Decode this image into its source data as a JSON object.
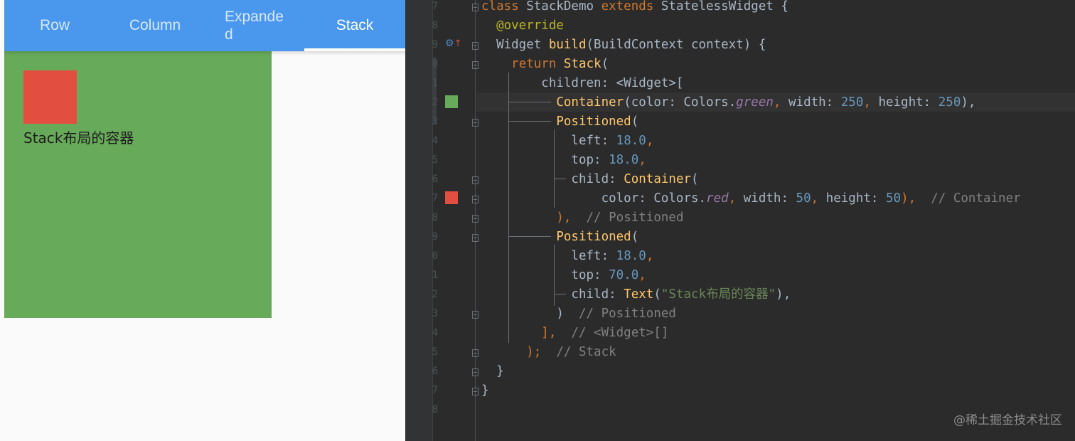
{
  "app": {
    "tabs": [
      {
        "label": "Row"
      },
      {
        "label": "Column"
      },
      {
        "label": "Expanded"
      },
      {
        "label": "Stack"
      }
    ],
    "active_tab": "Stack",
    "stack_text": "Stack布局的容器",
    "colors": {
      "tabbar": "#4a97ee",
      "green": "#67aa5a",
      "red": "#e24e3f"
    }
  },
  "editor": {
    "line_numbers": [
      "7",
      "8",
      "9",
      "0",
      "1",
      "2",
      "3",
      "4",
      "5",
      "6",
      "7",
      "8",
      "9",
      "0",
      "1",
      "2",
      "3",
      "4",
      "5",
      "6",
      "7",
      "8"
    ],
    "code_lines": [
      [
        {
          "t": "class ",
          "c": "kw"
        },
        {
          "t": "StackDemo "
        },
        {
          "t": "extends ",
          "c": "kw"
        },
        {
          "t": "StatelessWidget {"
        }
      ],
      [
        {
          "t": "  "
        },
        {
          "t": "@override",
          "c": "an"
        }
      ],
      [
        {
          "t": "  Widget "
        },
        {
          "t": "build",
          "c": "fn"
        },
        {
          "t": "(BuildContext context) {"
        }
      ],
      [
        {
          "t": "    "
        },
        {
          "t": "return ",
          "c": "kw"
        },
        {
          "t": "Stack",
          "c": "fn"
        },
        {
          "t": "("
        }
      ],
      [
        {
          "t": "        children: <Widget>["
        }
      ],
      [
        {
          "t": "          "
        },
        {
          "t": "Container",
          "c": "fn"
        },
        {
          "t": "(color: Colors."
        },
        {
          "t": "green",
          "c": "it"
        },
        {
          "t": ", ",
          "c": "kw"
        },
        {
          "t": "width: "
        },
        {
          "t": "250",
          "c": "nm"
        },
        {
          "t": ", ",
          "c": "kw"
        },
        {
          "t": "height: "
        },
        {
          "t": "250",
          "c": "nm"
        },
        {
          "t": "),"
        },
        {
          "t": "",
          "c": "kw"
        }
      ],
      [
        {
          "t": "          "
        },
        {
          "t": "Positioned",
          "c": "fn"
        },
        {
          "t": "("
        }
      ],
      [
        {
          "t": "            left: "
        },
        {
          "t": "18.0",
          "c": "nm"
        },
        {
          "t": ",",
          "c": "kw"
        }
      ],
      [
        {
          "t": "            top: "
        },
        {
          "t": "18.0",
          "c": "nm"
        },
        {
          "t": ",",
          "c": "kw"
        }
      ],
      [
        {
          "t": "            child: "
        },
        {
          "t": "Container",
          "c": "fn"
        },
        {
          "t": "("
        }
      ],
      [
        {
          "t": "                color: Colors."
        },
        {
          "t": "red",
          "c": "it"
        },
        {
          "t": ", ",
          "c": "kw"
        },
        {
          "t": "width: "
        },
        {
          "t": "50",
          "c": "nm"
        },
        {
          "t": ", ",
          "c": "kw"
        },
        {
          "t": "height: "
        },
        {
          "t": "50",
          "c": "nm"
        },
        {
          "t": "), ",
          "c": "kw"
        },
        {
          "t": " // Container",
          "c": "cm"
        }
      ],
      [
        {
          "t": "          ),",
          "c": "kw"
        },
        {
          "t": "  // Positioned",
          "c": "cm"
        }
      ],
      [
        {
          "t": "          "
        },
        {
          "t": "Positioned",
          "c": "fn"
        },
        {
          "t": "("
        }
      ],
      [
        {
          "t": "            left: "
        },
        {
          "t": "18.0",
          "c": "nm"
        },
        {
          "t": ",",
          "c": "kw"
        }
      ],
      [
        {
          "t": "            top: "
        },
        {
          "t": "70.0",
          "c": "nm"
        },
        {
          "t": ",",
          "c": "kw"
        }
      ],
      [
        {
          "t": "            child: "
        },
        {
          "t": "Text",
          "c": "fn"
        },
        {
          "t": "("
        },
        {
          "t": "\"Stack布局的容器\"",
          "c": "st"
        },
        {
          "t": "),"
        },
        {
          "t": "",
          "c": "kw"
        }
      ],
      [
        {
          "t": "          )"
        },
        {
          "t": "  // Positioned",
          "c": "cm"
        }
      ],
      [
        {
          "t": "        ],",
          "c": "kw"
        },
        {
          "t": "  // <Widget>[]",
          "c": "cm"
        }
      ],
      [
        {
          "t": "      );",
          "c": "kw"
        },
        {
          "t": "  // Stack",
          "c": "cm"
        }
      ],
      [
        {
          "t": "  }"
        }
      ],
      [
        {
          "t": "}"
        }
      ],
      [
        {
          "t": ""
        }
      ]
    ],
    "watermark": "@稀土掘金技术社区"
  }
}
